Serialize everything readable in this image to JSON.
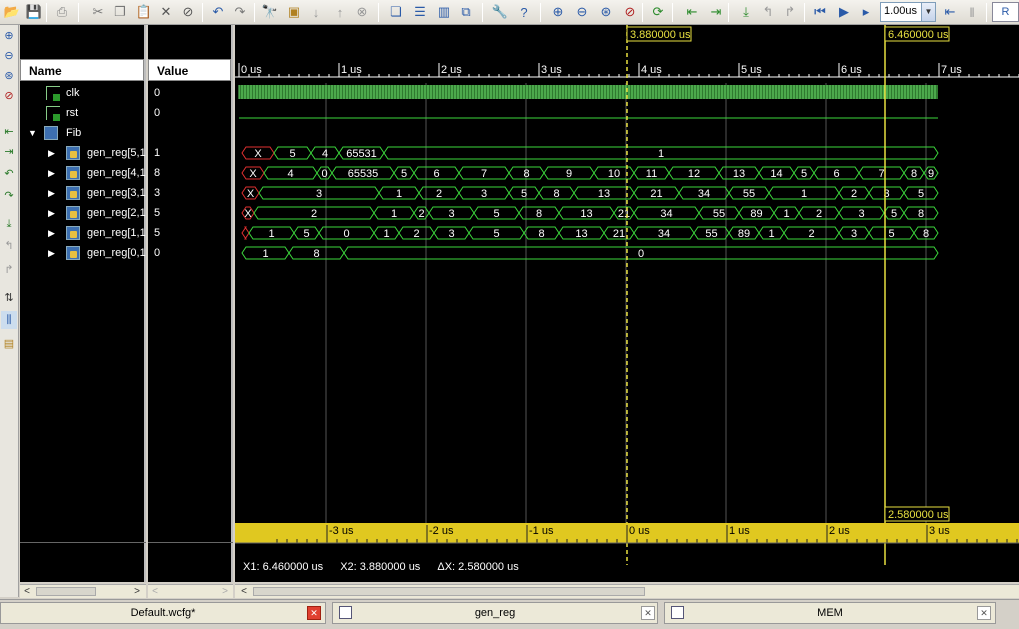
{
  "toolbar": {
    "zoom_value": "1.00us",
    "run_label": "R"
  },
  "signals": [
    {
      "name": "clk",
      "value": "0"
    },
    {
      "name": "rst",
      "value": "0"
    },
    {
      "name": "Fib",
      "value": ""
    },
    {
      "name": "gen_reg[5,1",
      "value": "1"
    },
    {
      "name": "gen_reg[4,1",
      "value": "8"
    },
    {
      "name": "gen_reg[3,1",
      "value": "3"
    },
    {
      "name": "gen_reg[2,1",
      "value": "5"
    },
    {
      "name": "gen_reg[1,1",
      "value": "5"
    },
    {
      "name": "gen_reg[0,1",
      "value": "0"
    }
  ],
  "columns": {
    "name": "Name",
    "value": "Value"
  },
  "cursors": {
    "x2_label": "3.880000 us",
    "x1_label": "6.460000 us",
    "delta_label": "2.580000 us"
  },
  "time_ruler": [
    "0 us",
    "1 us",
    "2 us",
    "3 us",
    "4 us",
    "5 us",
    "6 us",
    "7 us"
  ],
  "delta_ruler": [
    "-3 us",
    "-2 us",
    "-1 us",
    "0 us",
    "1 us",
    "2 us",
    "3 us"
  ],
  "waves": [
    {
      "segments": [
        [
          0.03,
          0.35,
          "X"
        ],
        [
          0.35,
          0.72,
          "5"
        ],
        [
          0.72,
          1.0,
          "4"
        ],
        [
          1.0,
          1.45,
          "65531"
        ],
        [
          1.45,
          6.99,
          "1"
        ]
      ]
    },
    {
      "segments": [
        [
          0.03,
          0.25,
          "X"
        ],
        [
          0.25,
          0.78,
          "4"
        ],
        [
          0.78,
          0.93,
          "0"
        ],
        [
          0.93,
          1.55,
          "65535"
        ],
        [
          1.55,
          1.75,
          "5"
        ],
        [
          1.75,
          2.2,
          "6"
        ],
        [
          2.2,
          2.7,
          "7"
        ],
        [
          2.7,
          3.05,
          "8"
        ],
        [
          3.05,
          3.55,
          "9"
        ],
        [
          3.55,
          3.95,
          "10"
        ],
        [
          3.95,
          4.3,
          "11"
        ],
        [
          4.3,
          4.8,
          "12"
        ],
        [
          4.8,
          5.2,
          "13"
        ],
        [
          5.2,
          5.55,
          "14"
        ],
        [
          5.55,
          5.75,
          "5"
        ],
        [
          5.75,
          6.2,
          "6"
        ],
        [
          6.2,
          6.65,
          "7"
        ],
        [
          6.65,
          6.85,
          "8"
        ],
        [
          6.85,
          6.99,
          "9"
        ]
      ]
    },
    {
      "segments": [
        [
          0.03,
          0.2,
          "X"
        ],
        [
          0.2,
          1.4,
          "3"
        ],
        [
          1.4,
          1.8,
          "1"
        ],
        [
          1.8,
          2.2,
          "2"
        ],
        [
          2.2,
          2.7,
          "3"
        ],
        [
          2.7,
          3.0,
          "5"
        ],
        [
          3.0,
          3.35,
          "8"
        ],
        [
          3.35,
          3.95,
          "13"
        ],
        [
          3.95,
          4.4,
          "21"
        ],
        [
          4.4,
          4.9,
          "34"
        ],
        [
          4.9,
          5.3,
          "55"
        ],
        [
          5.3,
          6.0,
          "1"
        ],
        [
          6.0,
          6.3,
          "2"
        ],
        [
          6.3,
          6.65,
          "3"
        ],
        [
          6.65,
          6.99,
          "5"
        ]
      ]
    },
    {
      "segments": [
        [
          0.03,
          0.15,
          "X"
        ],
        [
          0.15,
          1.35,
          "2"
        ],
        [
          1.35,
          1.75,
          "1"
        ],
        [
          1.75,
          1.9,
          "2"
        ],
        [
          1.9,
          2.35,
          "3"
        ],
        [
          2.35,
          2.8,
          "5"
        ],
        [
          2.8,
          3.2,
          "8"
        ],
        [
          3.2,
          3.75,
          "13"
        ],
        [
          3.75,
          3.95,
          "21"
        ],
        [
          3.95,
          4.6,
          "34"
        ],
        [
          4.6,
          5.0,
          "55"
        ],
        [
          5.0,
          5.35,
          "89"
        ],
        [
          5.35,
          5.6,
          "1"
        ],
        [
          5.6,
          6.0,
          "2"
        ],
        [
          6.0,
          6.45,
          "3"
        ],
        [
          6.45,
          6.65,
          "5"
        ],
        [
          6.65,
          6.99,
          "8"
        ]
      ]
    },
    {
      "segments": [
        [
          0.03,
          0.1,
          ""
        ],
        [
          0.1,
          0.55,
          "1"
        ],
        [
          0.55,
          0.8,
          "5"
        ],
        [
          0.8,
          1.35,
          "0"
        ],
        [
          1.35,
          1.6,
          "1"
        ],
        [
          1.6,
          1.95,
          "2"
        ],
        [
          1.95,
          2.3,
          "3"
        ],
        [
          2.3,
          2.85,
          "5"
        ],
        [
          2.85,
          3.2,
          "8"
        ],
        [
          3.2,
          3.65,
          "13"
        ],
        [
          3.65,
          3.95,
          "21"
        ],
        [
          3.95,
          4.55,
          "34"
        ],
        [
          4.55,
          4.9,
          "55"
        ],
        [
          4.9,
          5.2,
          "89"
        ],
        [
          5.2,
          5.45,
          "1"
        ],
        [
          5.45,
          6.0,
          "2"
        ],
        [
          6.0,
          6.3,
          "3"
        ],
        [
          6.3,
          6.75,
          "5"
        ],
        [
          6.75,
          6.99,
          "8"
        ]
      ]
    },
    {
      "segments": [
        [
          0.03,
          0.5,
          "1"
        ],
        [
          0.5,
          1.05,
          "8"
        ],
        [
          1.05,
          6.99,
          "0"
        ]
      ]
    }
  ],
  "status": {
    "x1": "X1: 6.460000 us",
    "x2": "X2: 3.880000 us",
    "dx": "ΔX: 2.580000 us"
  },
  "tabs": [
    {
      "label": "Default.wcfg*"
    },
    {
      "label": "gen_reg"
    },
    {
      "label": "MEM"
    }
  ]
}
